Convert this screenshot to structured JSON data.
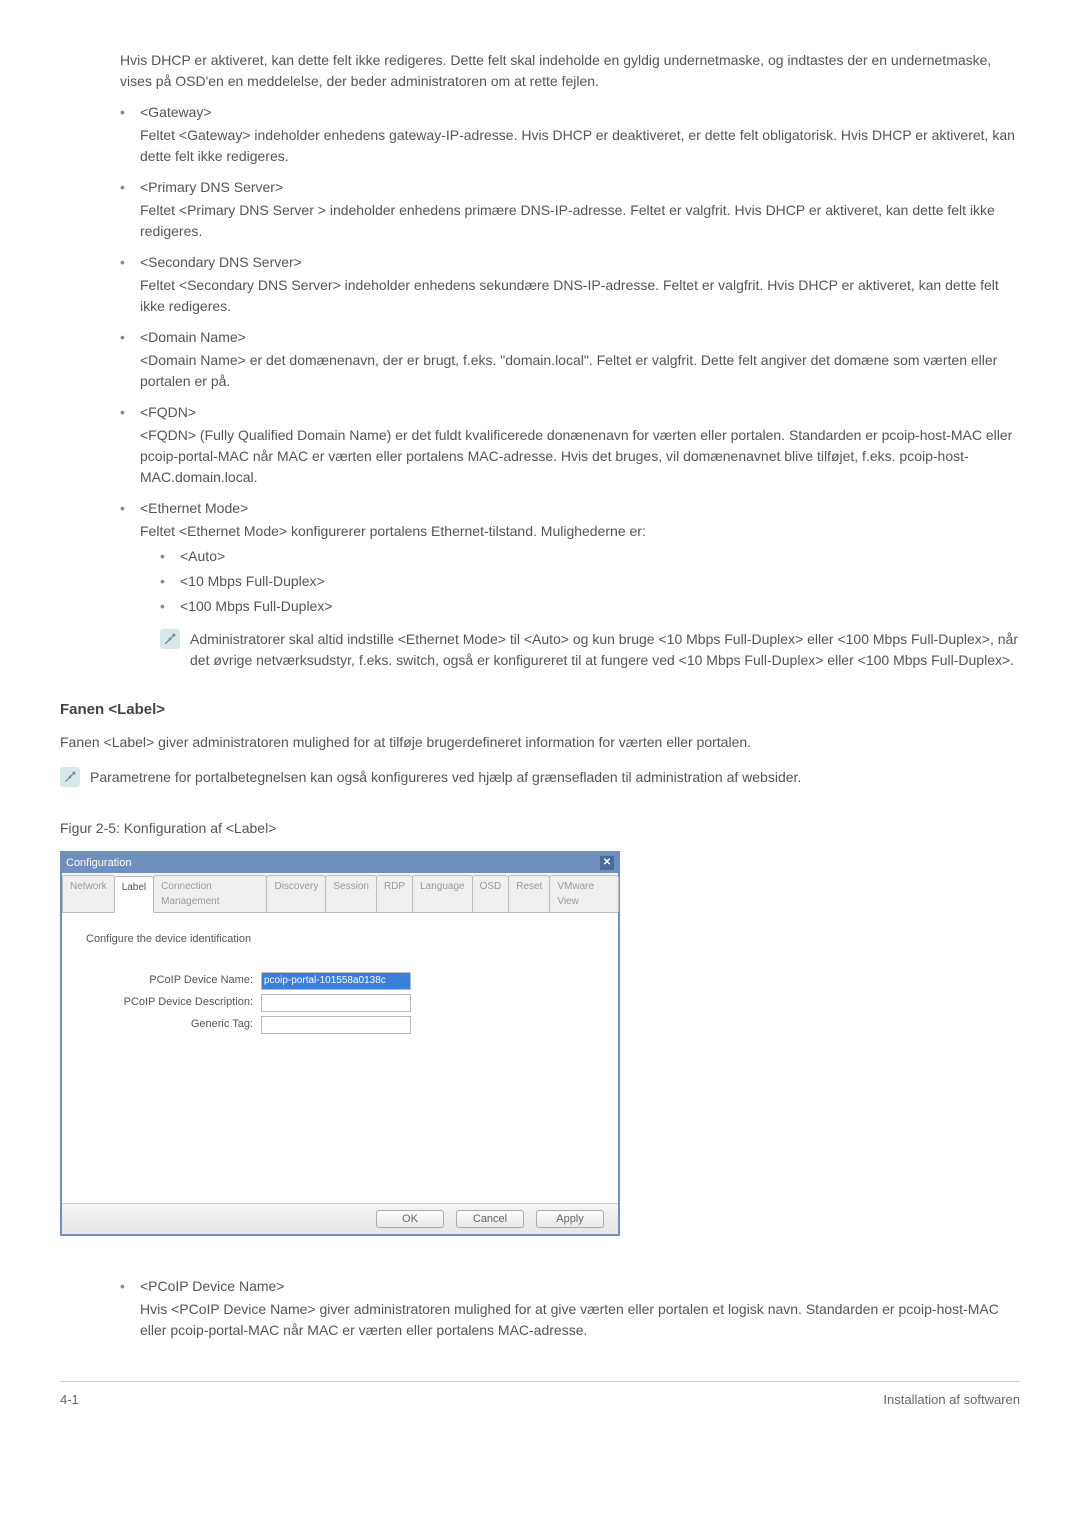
{
  "intro_para": "Hvis DHCP er aktiveret, kan dette felt ikke redigeres. Dette felt skal indeholde en gyldig undernetmaske, og indtastes der en undernetmaske, vises på OSD'en en meddelelse, der beder administratoren om at rette fejlen.",
  "items": [
    {
      "title": "<Gateway>",
      "desc": "Feltet <Gateway> indeholder enhedens gateway-IP-adresse. Hvis DHCP er deaktiveret, er dette felt obligatorisk. Hvis DHCP er aktiveret, kan dette felt ikke redigeres."
    },
    {
      "title": "<Primary DNS Server>",
      "desc": "Feltet <Primary DNS Server > indeholder enhedens primære DNS-IP-adresse. Feltet er valgfrit. Hvis DHCP er aktiveret, kan dette felt ikke redigeres."
    },
    {
      "title": "<Secondary DNS Server>",
      "desc": "Feltet <Secondary DNS Server> indeholder enhedens sekundære DNS-IP-adresse. Feltet er valgfrit. Hvis DHCP er aktiveret, kan dette felt ikke redigeres."
    },
    {
      "title": "<Domain Name>",
      "desc": "<Domain Name> er det domænenavn, der er brugt, f.eks. \"domain.local\". Feltet er valgfrit. Dette felt angiver det domæne som værten eller portalen er på."
    },
    {
      "title": "<FQDN>",
      "desc": "<FQDN> (Fully Qualified Domain Name) er det fuldt kvalificerede donænenavn for værten eller portalen. Standarden er pcoip-host-MAC eller pcoip-portal-MAC når MAC er værten eller portalens MAC-adresse. Hvis det bruges, vil domænenavnet blive tilføjet, f.eks. pcoip-host-MAC.domain.local."
    }
  ],
  "ethernet": {
    "title": "<Ethernet Mode>",
    "desc": "Feltet <Ethernet Mode> konfigurerer portalens Ethernet-tilstand. Mulighederne er:",
    "subs": [
      "<Auto>",
      "<10 Mbps Full-Duplex>",
      "<100 Mbps Full-Duplex>"
    ],
    "note": "Administratorer skal altid indstille <Ethernet Mode> til <Auto> og kun bruge <10 Mbps Full-Duplex> eller <100 Mbps Full-Duplex>, når det øvrige netværksudstyr, f.eks. switch, også er konfigureret til at fungere ved <10 Mbps Full-Duplex> eller <100 Mbps Full-Duplex>."
  },
  "section": {
    "heading": "Fanen <Label>",
    "para": "Fanen <Label> giver administratoren mulighed for at tilføje brugerdefineret information for værten eller portalen.",
    "note": "Parametrene for portalbetegnelsen kan også konfigureres ved hjælp af grænsefladen til administration af websider.",
    "fig_caption": "Figur 2-5: Konfiguration af <Label>"
  },
  "dialog": {
    "title": "Configuration",
    "tabs": [
      "Network",
      "Label",
      "Connection Management",
      "Discovery",
      "Session",
      "RDP",
      "Language",
      "OSD",
      "Reset",
      "VMware View"
    ],
    "active_tab_index": 1,
    "body_heading": "Configure the device identification",
    "fields": [
      {
        "label": "PCoIP Device Name:",
        "value": "pcoip-portal-101558a0138c",
        "highlight": true
      },
      {
        "label": "PCoIP Device Description:",
        "value": "",
        "highlight": false
      },
      {
        "label": "Generic Tag:",
        "value": "",
        "highlight": false
      }
    ],
    "buttons": {
      "ok": "OK",
      "cancel": "Cancel",
      "apply": "Apply"
    }
  },
  "last_item": {
    "title": "<PCoIP Device Name>",
    "desc": "Hvis <PCoIP Device Name> giver administratoren mulighed for at give værten eller portalen et logisk navn. Standarden er pcoip-host-MAC eller pcoip-portal-MAC når MAC er værten eller portalens MAC-adresse."
  },
  "footer": {
    "left": "4-1",
    "right": "Installation af softwaren"
  }
}
